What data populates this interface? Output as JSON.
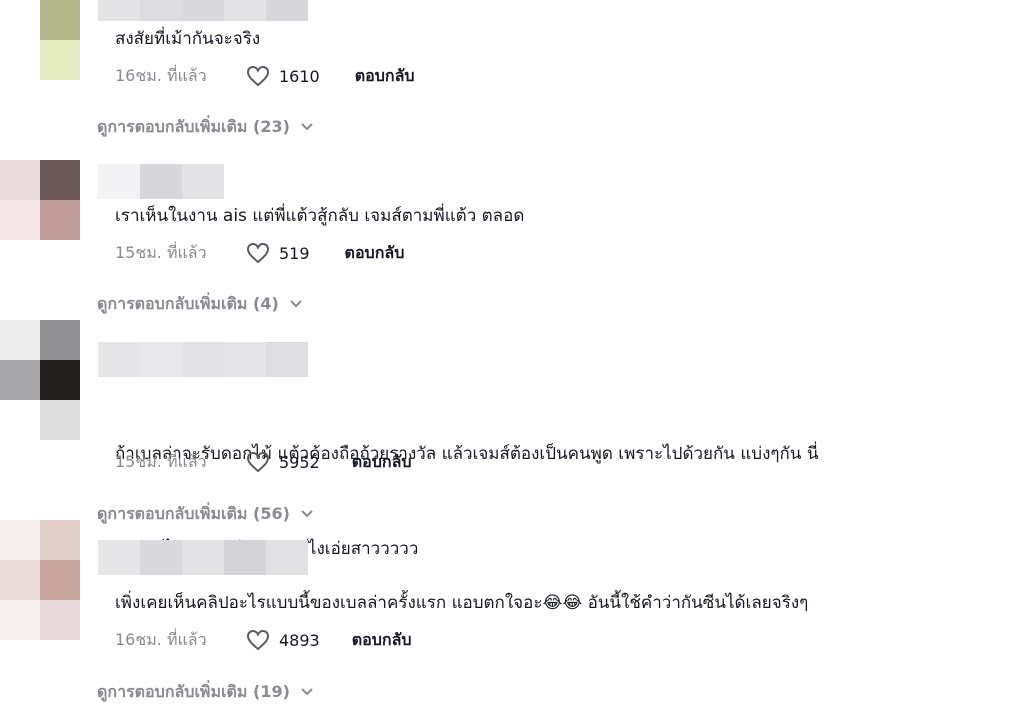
{
  "comments": [
    {
      "text": "สงสัยที่เม้ากันจะจริง",
      "time": "16ชม. ที่แล้ว",
      "likes": "1610",
      "reply": "ตอบกลับ",
      "more_replies": "ดูการตอบกลับเพิ่มเติม (23)"
    },
    {
      "text": "เราเห็นในงาน ais แต่พี่แต้วสู้กลับ เจมส์ตามพี่แต้ว ตลอด",
      "time": "15ชม. ที่แล้ว",
      "likes": "519",
      "reply": "ตอบกลับ",
      "more_replies": "ดูการตอบกลับเพิ่มเติม (4)"
    },
    {
      "text_line1": "ถ้าเบลล่าจะรับดอกไม้ แต้วค้องถือถ้วยรางวัล แล้วเจมส์ต้องเป็นคนพูด เพราะไปด้วยกัน แบ่งๆกัน นี่",
      "text_line2": "รวบตึงไว้อยู่คนเดียว มันยังไงเอ่ยสาววววว",
      "time": "15ชม. ที่แล้ว",
      "likes": "5952",
      "reply": "ตอบกลับ",
      "more_replies": "ดูการตอบกลับเพิ่มเติม (56)"
    },
    {
      "text": "เพิ่งเคยเห็นคลิปอะไรแบบนี้ของเบลล่าครั้งแรก แอบตกใจอะ😂😂 อันนี้ใช้คำว่ากันซีนได้เลยจริงๆ",
      "time": "16ชม. ที่แล้ว",
      "likes": "4893",
      "reply": "ตอบกลับ",
      "more_replies": "ดูการตอบกลับเพิ่มเติม (19)"
    }
  ],
  "icons": {
    "like": "heart-outline-icon",
    "expand": "chevron-down-icon"
  }
}
